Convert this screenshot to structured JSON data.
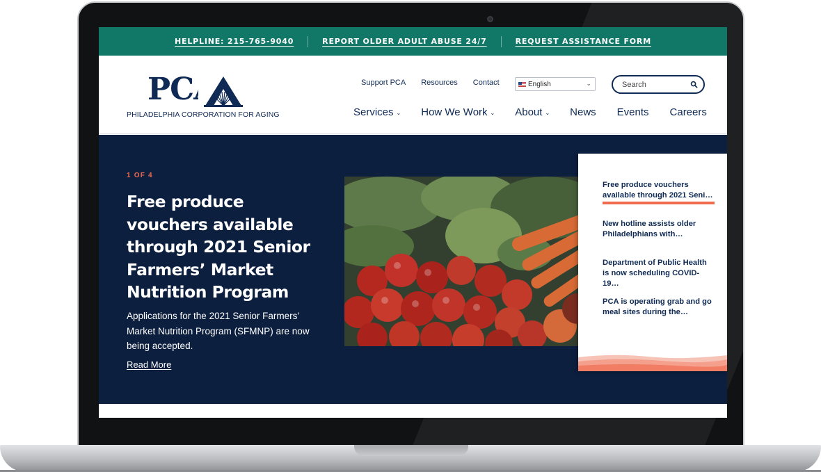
{
  "utility_bar": {
    "links": [
      {
        "label": "HELPLINE: 215-765-9040"
      },
      {
        "label": "REPORT OLDER ADULT ABUSE 24/7"
      },
      {
        "label": "REQUEST ASSISTANCE FORM"
      }
    ]
  },
  "logo": {
    "wordmark": "PCA",
    "subtitle": "PHILADELPHIA CORPORATION FOR AGING"
  },
  "secondary_nav": {
    "links": [
      "Support PCA",
      "Resources",
      "Contact"
    ],
    "language": {
      "selected": "English"
    }
  },
  "search": {
    "placeholder": "Search"
  },
  "main_nav": {
    "items": [
      {
        "label": "Services",
        "has_dropdown": true
      },
      {
        "label": "How We Work",
        "has_dropdown": true
      },
      {
        "label": "About",
        "has_dropdown": true
      },
      {
        "label": "News",
        "has_dropdown": false
      },
      {
        "label": "Events",
        "has_dropdown": false
      },
      {
        "label": "Careers",
        "has_dropdown": false
      }
    ]
  },
  "hero": {
    "counter": "1 OF 4",
    "title": "Free produce vouchers available through 2021 Senior Farmers’ Market Nutrition Program",
    "description": "Applications for the 2021 Senior Farmers’ Market Nutrition Program (SFMNP) are now being accepted.",
    "read_more": "Read More"
  },
  "stories": {
    "items": [
      {
        "line1": "Free produce vouchers",
        "line2": "available through 2021 Seni…",
        "active": true
      },
      {
        "line1": "New hotline assists older",
        "line2": "Philadelphians with…",
        "active": false
      },
      {
        "line1": "Department of Public Health",
        "line2": "is now scheduling COVID-19…",
        "active": false
      },
      {
        "line1": "PCA is operating grab and go",
        "line2": "meal sites during the…",
        "active": false
      }
    ]
  },
  "colors": {
    "utility_bar": "#117766",
    "brand_navy": "#0f2a55",
    "hero_background": "#0c1f3f",
    "accent_coral": "#f06a4e"
  }
}
